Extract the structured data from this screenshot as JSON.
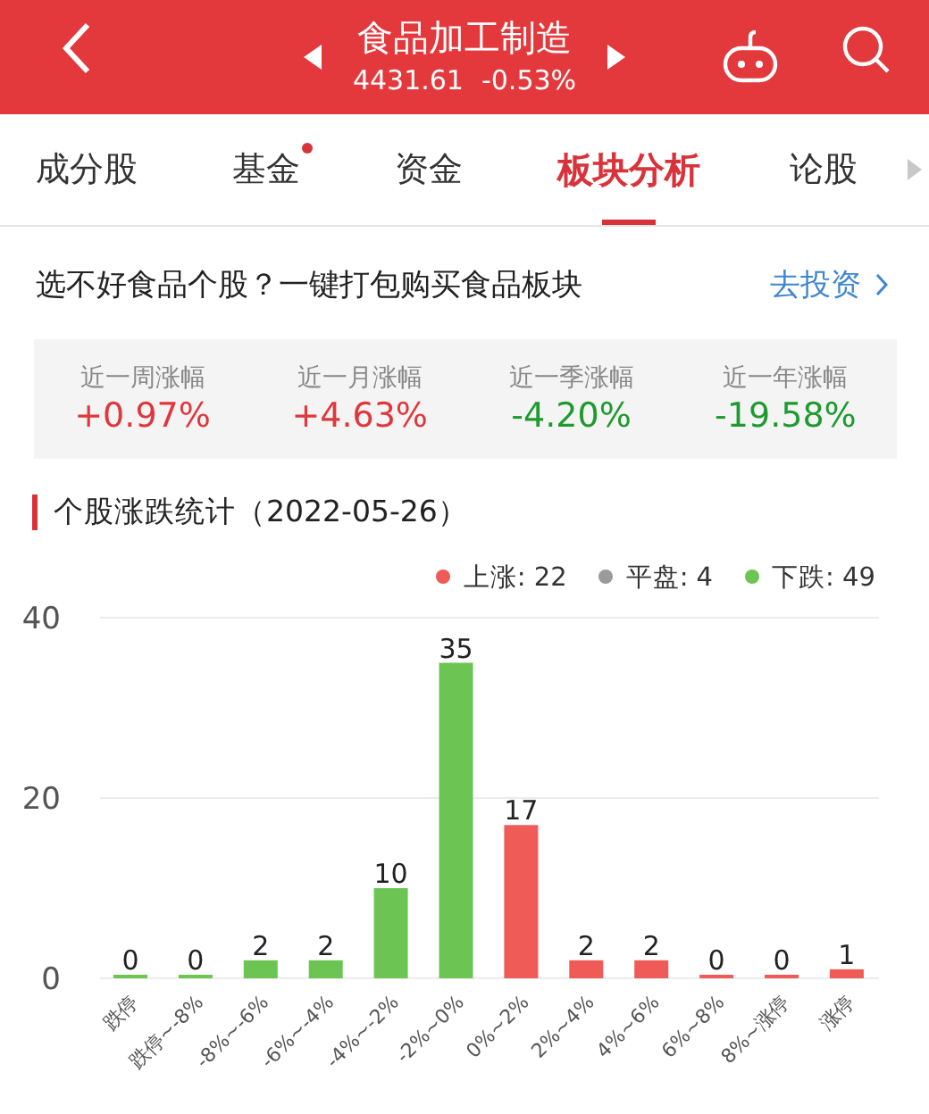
{
  "header": {
    "title": "食品加工制造",
    "price": "4431.61",
    "change": "-0.53%"
  },
  "tabs": [
    {
      "label": "成分股",
      "selected": false,
      "badge": false
    },
    {
      "label": "基金",
      "selected": false,
      "badge": true
    },
    {
      "label": "资金",
      "selected": false,
      "badge": false
    },
    {
      "label": "板块分析",
      "selected": true,
      "badge": false
    },
    {
      "label": "论股",
      "selected": false,
      "badge": false
    }
  ],
  "promo": {
    "text": "选不好食品个股？一键打包购买食品板块",
    "link": "去投资"
  },
  "stats": [
    {
      "label": "近一周涨幅",
      "value": "+0.97%",
      "color": "#e0373c"
    },
    {
      "label": "近一月涨幅",
      "value": "+4.63%",
      "color": "#e0373c"
    },
    {
      "label": "近一季涨幅",
      "value": "-4.20%",
      "color": "#1e9a2e"
    },
    {
      "label": "近一年涨幅",
      "value": "-19.58%",
      "color": "#1e9a2e"
    }
  ],
  "section_title": "个股涨跌统计（2022-05-26）",
  "legend": [
    {
      "label": "上涨: 22",
      "color": "#ef5b57"
    },
    {
      "label": "平盘: 4",
      "color": "#9a9a9a"
    },
    {
      "label": "下跌: 49",
      "color": "#6cc553"
    }
  ],
  "chart_data": {
    "type": "bar",
    "categories": [
      "跌停",
      "跌停~-8%",
      "-8%~-6%",
      "-6%~-4%",
      "-4%~-2%",
      "-2%~0%",
      "0%~2%",
      "2%~4%",
      "4%~6%",
      "6%~8%",
      "8%~涨停",
      "涨停"
    ],
    "series": [
      {
        "color": "#6cc553",
        "values": [
          0,
          0,
          2,
          2,
          10,
          35,
          null,
          null,
          null,
          null,
          null,
          null
        ]
      },
      {
        "color": "#ef5b57",
        "values": [
          null,
          null,
          null,
          null,
          null,
          null,
          17,
          2,
          2,
          0,
          0,
          1
        ]
      }
    ],
    "ylim": [
      0,
      40
    ],
    "yticks": [
      0,
      20,
      40
    ],
    "stacked": true,
    "data_labels": true
  }
}
